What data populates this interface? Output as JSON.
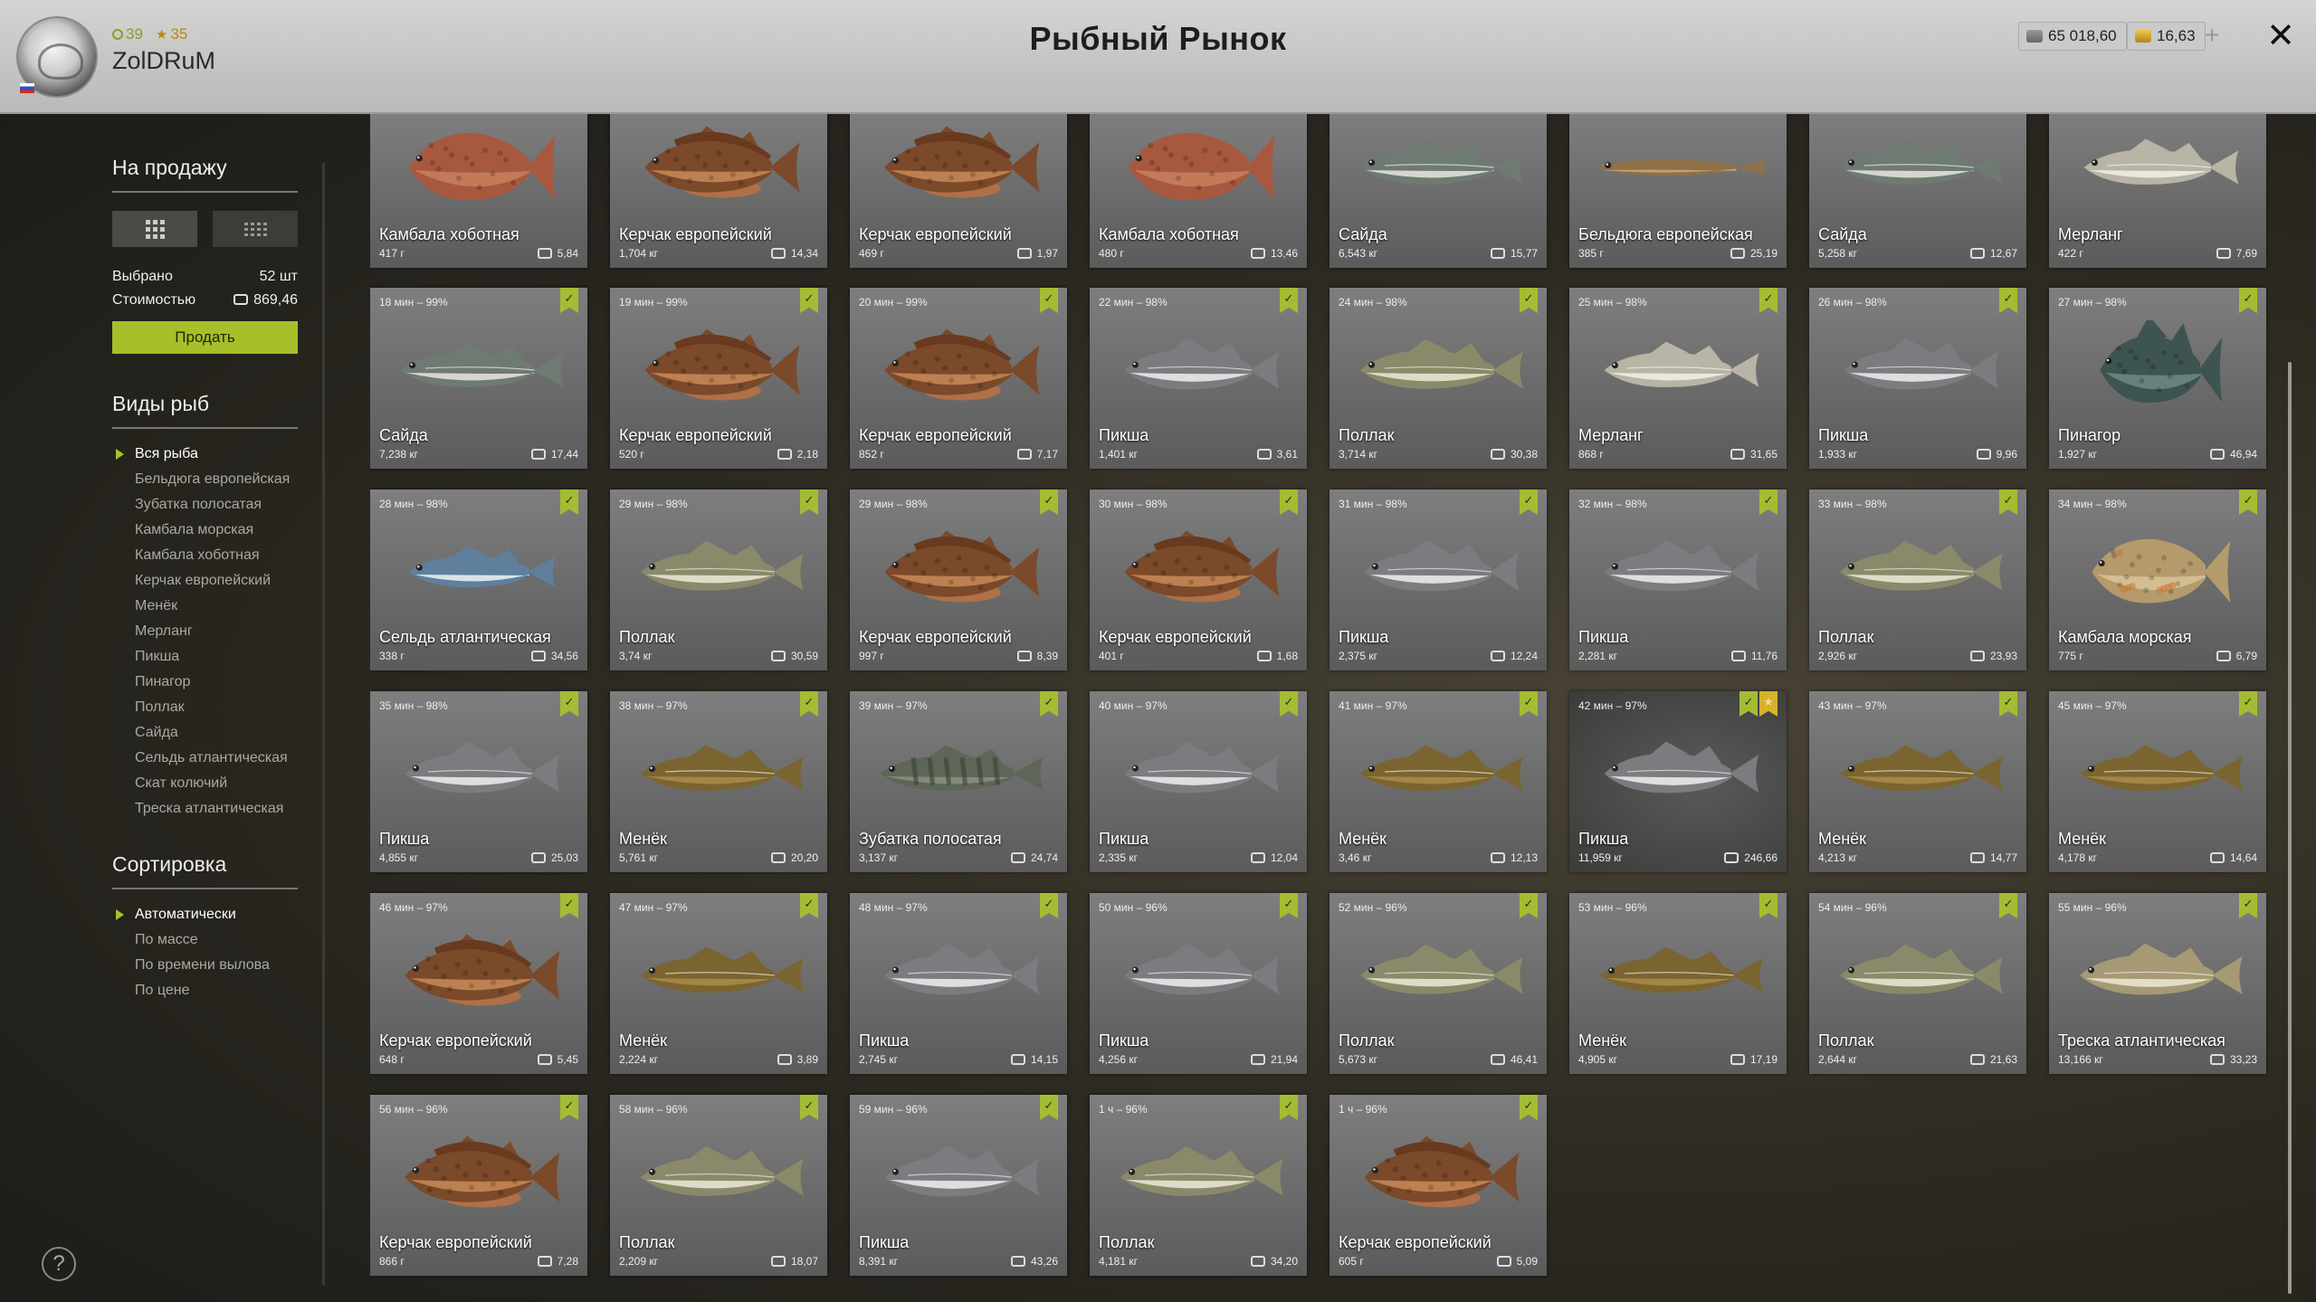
{
  "header": {
    "title": "Рыбный Рынок",
    "username": "ZolDRuM",
    "level": "39",
    "rank": "35",
    "silver": "65 018,60",
    "gold": "16,63"
  },
  "sidebar": {
    "for_sale_title": "На продажу",
    "selected_label": "Выбрано",
    "selected_value": "52 шт",
    "cost_label": "Стоимостью",
    "cost_value": "869,46",
    "sell_label": "Продать",
    "species_title": "Виды рыб",
    "species": [
      "Вся рыба",
      "Бельдюга европейская",
      "Зубатка полосатая",
      "Камбала морская",
      "Камбала хоботная",
      "Керчак европейский",
      "Менёк",
      "Мерланг",
      "Пикша",
      "Пинагор",
      "Поллак",
      "Сайда",
      "Сельдь атлантическая",
      "Скат колючий",
      "Треска атлантическая"
    ],
    "sort_title": "Сортировка",
    "sort": [
      "Автоматически",
      "По массе",
      "По времени вылова",
      "По цене"
    ]
  },
  "colors": {
    "accent": "#a5c02a",
    "badge": "#a4bc34",
    "star": "#d7b22a"
  },
  "cards": [
    {
      "time": "",
      "name": "Камбала хоботная",
      "weight": "417 г",
      "price": "5,84",
      "type": "flat"
    },
    {
      "time": "",
      "name": "Керчак европейский",
      "weight": "1,704 кг",
      "price": "14,34",
      "type": "sculpin"
    },
    {
      "time": "",
      "name": "Керчак европейский",
      "weight": "469 г",
      "price": "1,97",
      "type": "sculpin"
    },
    {
      "time": "",
      "name": "Камбала хоботная",
      "weight": "480 г",
      "price": "13,46",
      "type": "flat"
    },
    {
      "time": "",
      "name": "Сайда",
      "weight": "6,543 кг",
      "price": "15,77",
      "type": "saithe"
    },
    {
      "time": "",
      "name": "Бельдюга европейская",
      "weight": "385 г",
      "price": "25,19",
      "type": "eel"
    },
    {
      "time": "",
      "name": "Сайда",
      "weight": "5,258 кг",
      "price": "12,67",
      "type": "saithe"
    },
    {
      "time": "",
      "name": "Мерланг",
      "weight": "422 г",
      "price": "7,69",
      "type": "whiting"
    },
    {
      "time": "18 мин – 99%",
      "name": "Сайда",
      "weight": "7,238 кг",
      "price": "17,44",
      "type": "saithe"
    },
    {
      "time": "19 мин – 99%",
      "name": "Керчак европейский",
      "weight": "520 г",
      "price": "2,18",
      "type": "sculpin"
    },
    {
      "time": "20 мин – 99%",
      "name": "Керчак европейский",
      "weight": "852 г",
      "price": "7,17",
      "type": "sculpin"
    },
    {
      "time": "22 мин – 98%",
      "name": "Пикша",
      "weight": "1,401 кг",
      "price": "3,61",
      "type": "haddock"
    },
    {
      "time": "24 мин – 98%",
      "name": "Поллак",
      "weight": "3,714 кг",
      "price": "30,38",
      "type": "pollack"
    },
    {
      "time": "25 мин – 98%",
      "name": "Мерланг",
      "weight": "868 г",
      "price": "31,65",
      "type": "whiting"
    },
    {
      "time": "26 мин – 98%",
      "name": "Пикша",
      "weight": "1,933 кг",
      "price": "9,96",
      "type": "haddock"
    },
    {
      "time": "27 мин – 98%",
      "name": "Пинагор",
      "weight": "1,927 кг",
      "price": "46,94",
      "type": "lump"
    },
    {
      "time": "28 мин – 98%",
      "name": "Сельдь атлантическая",
      "weight": "338 г",
      "price": "34,56",
      "type": "herring"
    },
    {
      "time": "29 мин – 98%",
      "name": "Поллак",
      "weight": "3,74 кг",
      "price": "30,59",
      "type": "pollack"
    },
    {
      "time": "29 мин – 98%",
      "name": "Керчак европейский",
      "weight": "997 г",
      "price": "8,39",
      "type": "sculpin"
    },
    {
      "time": "30 мин – 98%",
      "name": "Керчак европейский",
      "weight": "401 г",
      "price": "1,68",
      "type": "sculpin"
    },
    {
      "time": "31 мин – 98%",
      "name": "Пикша",
      "weight": "2,375 кг",
      "price": "12,24",
      "type": "haddock"
    },
    {
      "time": "32 мин – 98%",
      "name": "Пикша",
      "weight": "2,281 кг",
      "price": "11,76",
      "type": "haddock"
    },
    {
      "time": "33 мин – 98%",
      "name": "Поллак",
      "weight": "2,926 кг",
      "price": "23,93",
      "type": "pollack"
    },
    {
      "time": "34 мин – 98%",
      "name": "Камбала морская",
      "weight": "775 г",
      "price": "6,79",
      "type": "plaice"
    },
    {
      "time": "35 мин – 98%",
      "name": "Пикша",
      "weight": "4,855 кг",
      "price": "25,03",
      "type": "haddock"
    },
    {
      "time": "38 мин – 97%",
      "name": "Менёк",
      "weight": "5,761 кг",
      "price": "20,20",
      "type": "tusk"
    },
    {
      "time": "39 мин – 97%",
      "name": "Зубатка полосатая",
      "weight": "3,137 кг",
      "price": "24,74",
      "type": "wolf"
    },
    {
      "time": "40 мин – 97%",
      "name": "Пикша",
      "weight": "2,335 кг",
      "price": "12,04",
      "type": "haddock"
    },
    {
      "time": "41 мин – 97%",
      "name": "Менёк",
      "weight": "3,46 кг",
      "price": "12,13",
      "type": "tusk"
    },
    {
      "time": "42 мин – 97%",
      "name": "Пикша",
      "weight": "11,959 кг",
      "price": "246,66",
      "type": "haddock",
      "star": true,
      "selected": true
    },
    {
      "time": "43 мин – 97%",
      "name": "Менёк",
      "weight": "4,213 кг",
      "price": "14,77",
      "type": "tusk"
    },
    {
      "time": "45 мин – 97%",
      "name": "Менёк",
      "weight": "4,178 кг",
      "price": "14,64",
      "type": "tusk"
    },
    {
      "time": "46 мин – 97%",
      "name": "Керчак европейский",
      "weight": "648 г",
      "price": "5,45",
      "type": "sculpin"
    },
    {
      "time": "47 мин – 97%",
      "name": "Менёк",
      "weight": "2,224 кг",
      "price": "3,89",
      "type": "tusk"
    },
    {
      "time": "48 мин – 97%",
      "name": "Пикша",
      "weight": "2,745 кг",
      "price": "14,15",
      "type": "haddock"
    },
    {
      "time": "50 мин – 96%",
      "name": "Пикша",
      "weight": "4,256 кг",
      "price": "21,94",
      "type": "haddock"
    },
    {
      "time": "52 мин – 96%",
      "name": "Поллак",
      "weight": "5,673 кг",
      "price": "46,41",
      "type": "pollack"
    },
    {
      "time": "53 мин – 96%",
      "name": "Менёк",
      "weight": "4,905 кг",
      "price": "17,19",
      "type": "tusk"
    },
    {
      "time": "54 мин – 96%",
      "name": "Поллак",
      "weight": "2,644 кг",
      "price": "21,63",
      "type": "pollack"
    },
    {
      "time": "55 мин – 96%",
      "name": "Треска атлантическая",
      "weight": "13,166 кг",
      "price": "33,23",
      "type": "cod"
    },
    {
      "time": "56 мин – 96%",
      "name": "Керчак европейский",
      "weight": "866 г",
      "price": "7,28",
      "type": "sculpin"
    },
    {
      "time": "58 мин – 96%",
      "name": "Поллак",
      "weight": "2,209 кг",
      "price": "18,07",
      "type": "pollack"
    },
    {
      "time": "59 мин – 96%",
      "name": "Пикша",
      "weight": "8,391 кг",
      "price": "43,26",
      "type": "haddock"
    },
    {
      "time": "1 ч – 96%",
      "name": "Поллак",
      "weight": "4,181 кг",
      "price": "34,20",
      "type": "pollack"
    },
    {
      "time": "1 ч – 96%",
      "name": "Керчак европейский",
      "weight": "605 г",
      "price": "5,09",
      "type": "sculpin"
    }
  ]
}
